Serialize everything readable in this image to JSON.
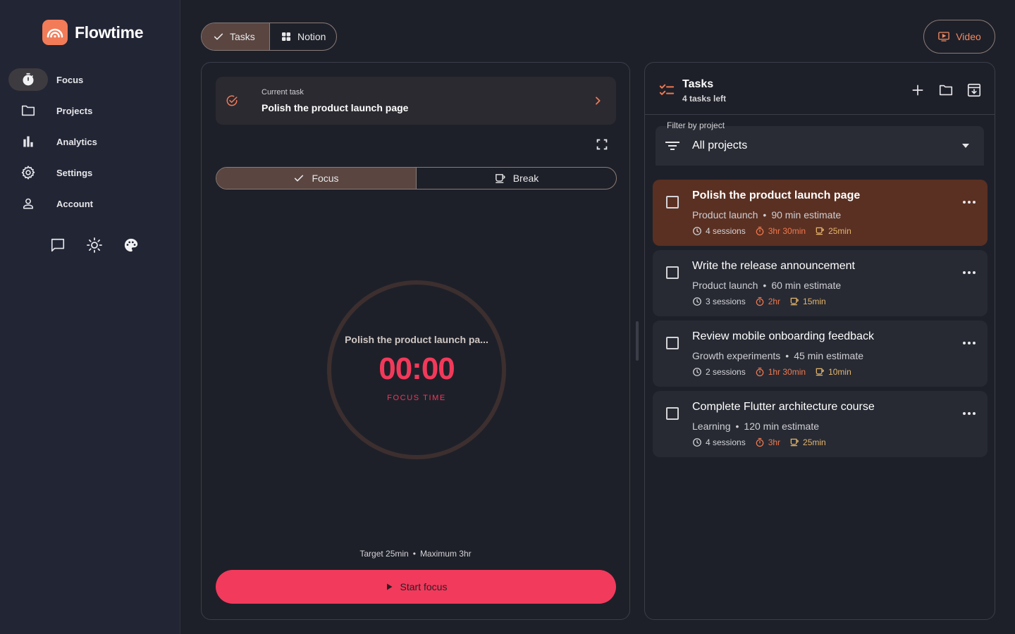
{
  "app": {
    "name": "Flowtime"
  },
  "sidebar": {
    "items": [
      {
        "label": "Focus",
        "icon": "stopwatch-icon",
        "active": true
      },
      {
        "label": "Projects",
        "icon": "folder-icon",
        "active": false
      },
      {
        "label": "Analytics",
        "icon": "bar-chart-icon",
        "active": false
      },
      {
        "label": "Settings",
        "icon": "gear-icon",
        "active": false
      },
      {
        "label": "Account",
        "icon": "person-icon",
        "active": false
      }
    ],
    "actions": [
      "feedback-icon",
      "brightness-icon",
      "palette-icon"
    ]
  },
  "topbar": {
    "tabs": [
      {
        "label": "Tasks",
        "icon": "check-icon",
        "active": true
      },
      {
        "label": "Notion",
        "icon": "grid-icon",
        "active": false
      }
    ],
    "video_label": "Video"
  },
  "focus": {
    "current_task_label": "Current task",
    "current_task_title": "Polish the product launch page",
    "modes": [
      {
        "label": "Focus",
        "icon": "check-icon",
        "active": true
      },
      {
        "label": "Break",
        "icon": "coffee-icon",
        "active": false
      }
    ],
    "timer_task": "Polish the product launch pa...",
    "timer_time": "00:00",
    "timer_label": "FOCUS TIME",
    "target": "Target 25min",
    "maximum": "Maximum 3hr",
    "separator": "•",
    "start_label": "Start focus"
  },
  "tasks_panel": {
    "title": "Tasks",
    "subtitle": "4 tasks left",
    "filter_label": "Filter by project",
    "filter_value": "All projects",
    "separator": "•",
    "tasks": [
      {
        "title": "Polish the product launch page",
        "project": "Product launch",
        "estimate": "90 min estimate",
        "sessions": "4 sessions",
        "focus_time": "3hr 30min",
        "break_time": "25min",
        "selected": true
      },
      {
        "title": "Write the release announcement",
        "project": "Product launch",
        "estimate": "60 min estimate",
        "sessions": "3 sessions",
        "focus_time": "2hr",
        "break_time": "15min",
        "selected": false
      },
      {
        "title": "Review mobile onboarding feedback",
        "project": "Growth experiments",
        "estimate": "45 min estimate",
        "sessions": "2 sessions",
        "focus_time": "1hr 30min",
        "break_time": "10min",
        "selected": false
      },
      {
        "title": "Complete Flutter architecture course",
        "project": "Learning",
        "estimate": "120 min estimate",
        "sessions": "4 sessions",
        "focus_time": "3hr",
        "break_time": "25min",
        "selected": false
      }
    ]
  },
  "colors": {
    "accent": "#f23a5c",
    "brand": "#f27b58",
    "selected_task": "#5a3022",
    "focus_stat": "#f0784e",
    "break_stat": "#e5b56c"
  }
}
